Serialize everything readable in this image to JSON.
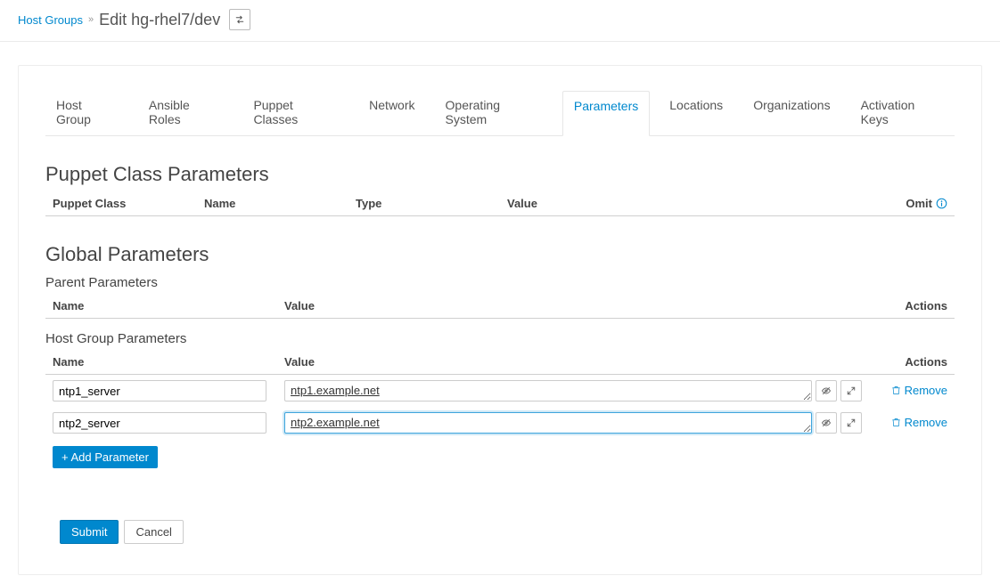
{
  "breadcrumb": {
    "root": "Host Groups",
    "sep": "»",
    "title": "Edit hg-rhel7/dev"
  },
  "tabs": [
    {
      "label": "Host Group"
    },
    {
      "label": "Ansible Roles"
    },
    {
      "label": "Puppet Classes"
    },
    {
      "label": "Network"
    },
    {
      "label": "Operating System"
    },
    {
      "label": "Parameters",
      "active": true
    },
    {
      "label": "Locations"
    },
    {
      "label": "Organizations"
    },
    {
      "label": "Activation Keys"
    }
  ],
  "puppet_section": {
    "title": "Puppet Class Parameters",
    "columns": {
      "c1": "Puppet Class",
      "c2": "Name",
      "c3": "Type",
      "c4": "Value",
      "c5": "Omit"
    }
  },
  "global_section": {
    "title": "Global Parameters",
    "parent_title": "Parent Parameters",
    "parent_columns": {
      "name": "Name",
      "value": "Value",
      "actions": "Actions"
    },
    "hg_title": "Host Group Parameters",
    "hg_columns": {
      "name": "Name",
      "value": "Value",
      "actions": "Actions"
    },
    "rows": [
      {
        "name": "ntp1_server",
        "value": "ntp1.example.net",
        "active": false
      },
      {
        "name": "ntp2_server",
        "value": "ntp2.example.net",
        "active": true
      }
    ],
    "add_label": "+ Add Parameter",
    "remove_label": "Remove"
  },
  "footer": {
    "submit": "Submit",
    "cancel": "Cancel"
  }
}
